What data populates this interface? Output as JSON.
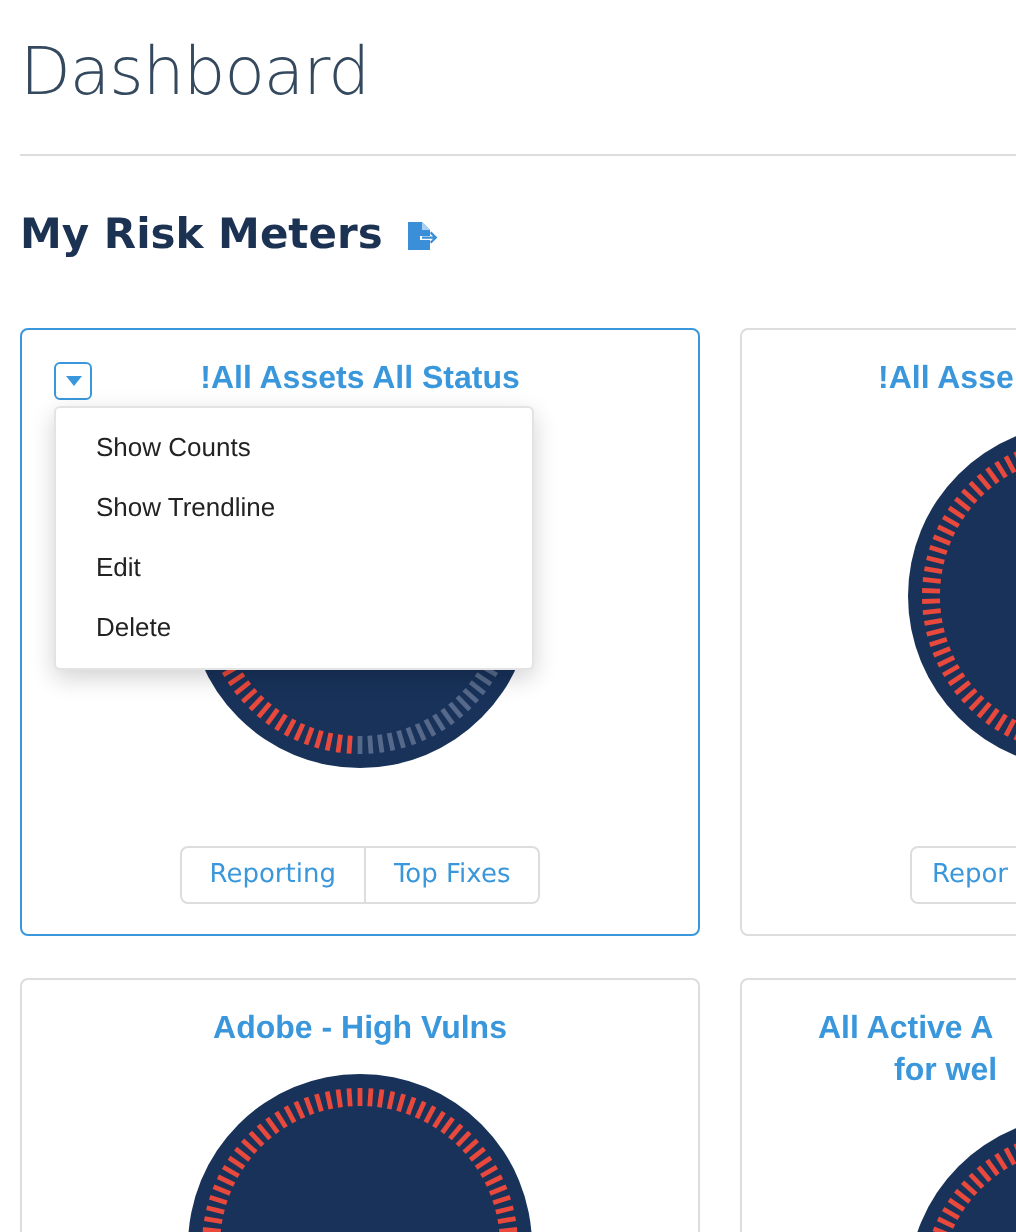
{
  "page": {
    "title": "Dashboard"
  },
  "section": {
    "title": "My Risk Meters"
  },
  "cards": [
    {
      "title_lines": [
        "!All Assets All Status"
      ],
      "clipped": false,
      "focused": true,
      "actions": [
        "Reporting",
        "Top Fixes"
      ],
      "menu": {
        "items": [
          "Show Counts",
          "Show Trendline",
          "Edit",
          "Delete"
        ]
      }
    },
    {
      "title_lines": [
        "!All Asse"
      ],
      "clipped": true,
      "focused": false,
      "actions": [
        "Repor"
      ]
    },
    {
      "title_lines": [
        "Adobe - High Vulns"
      ],
      "clipped": false,
      "focused": false
    },
    {
      "title_lines": [
        "All Active A",
        "for wel"
      ],
      "clipped": true,
      "focused": false
    }
  ]
}
